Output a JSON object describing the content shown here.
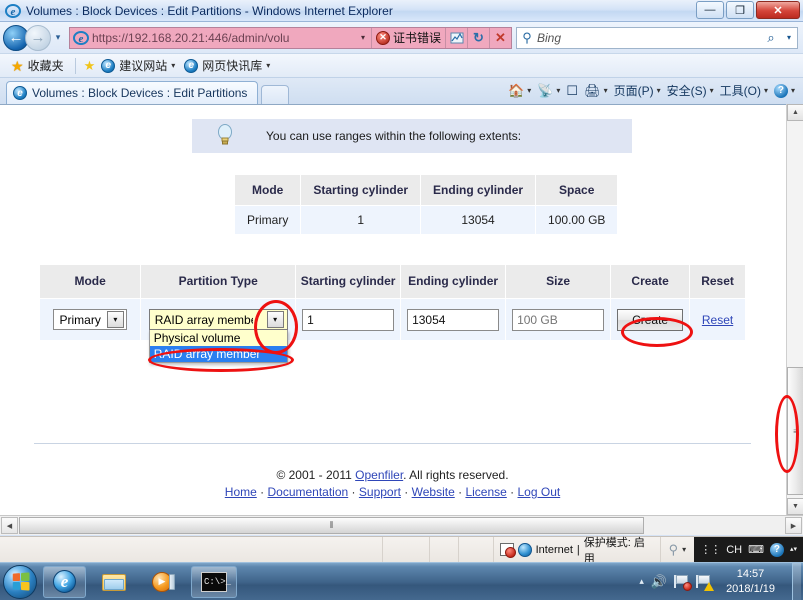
{
  "window": {
    "title": "Volumes : Block Devices : Edit Partitions - Windows Internet Explorer",
    "minimize_label": "—",
    "restore_label": "❐",
    "close_label": "✕"
  },
  "nav": {
    "back_label": "←",
    "forward_label": "→",
    "history_label": "▾",
    "url": "https://192.168.20.21:446/admin/volu",
    "url_dropdown_label": "▾",
    "cert_error_label": "证书错误",
    "cert_shield_label": "✕",
    "compat_view_label": "⛶",
    "refresh_label": "↻",
    "stop_label": "✕"
  },
  "search": {
    "placeholder": "Bing",
    "go_label": "⌕",
    "dropdown_label": "▾"
  },
  "favorites": {
    "favorites_label": "收藏夹",
    "items": [
      {
        "label": "建议网站",
        "caret": "▾"
      },
      {
        "label": "网页快讯库",
        "caret": "▾"
      }
    ]
  },
  "tabs": {
    "active_tab_label": "Volumes : Block Devices : Edit Partitions",
    "new_tab_label": ""
  },
  "commandbar": {
    "home_label": "",
    "feeds_label": "",
    "mail_label": "",
    "print_label": "",
    "page_label": "页面(P)",
    "safety_label": "安全(S)",
    "tools_label": "工具(O)",
    "help_label": "?",
    "caret": "▾"
  },
  "page": {
    "tip": {
      "icon": "lightbulb-icon",
      "text": "You can use ranges within the following extents:"
    },
    "extents_table": {
      "headers": [
        "Mode",
        "Starting cylinder",
        "Ending cylinder",
        "Space"
      ],
      "rows": [
        [
          "Primary",
          "1",
          "13054",
          "100.00 GB"
        ]
      ]
    },
    "create_table": {
      "headers": [
        "Mode",
        "Partition Type",
        "Starting cylinder",
        "Ending cylinder",
        "Size",
        "Create",
        "Reset"
      ],
      "row": {
        "mode_value": "Primary",
        "mode_arrow": "▾",
        "partition_type_value": "RAID array member",
        "partition_type_arrow": "▾",
        "partition_type_options": [
          "Physical volume",
          "RAID array member"
        ],
        "partition_type_selected_index": 1,
        "starting_cylinder_value": "1",
        "ending_cylinder_value": "13054",
        "size_placeholder": "100 GB",
        "create_label": "Create",
        "reset_label": "Reset"
      }
    },
    "footer": {
      "copyright_prefix": "© 2001 - 2011 ",
      "copyright_link": "Openfiler",
      "copyright_suffix": ". All rights reserved.",
      "links": [
        "Home",
        "Documentation",
        "Support",
        "Website",
        "License",
        "Log Out"
      ],
      "separator": "·"
    }
  },
  "scrollbars": {
    "v_up_label": "▲",
    "v_down_label": "▼",
    "v_thumb_grip": "≡",
    "h_left_label": "◀",
    "h_right_label": "▶",
    "h_thumb_grip": "⫴"
  },
  "statusbar": {
    "zone_label": "Internet",
    "separator": "|",
    "protected_mode_label": "保护模式: 启用",
    "zoom_caret": "▾",
    "ime_language": "CH",
    "ime_help": "?",
    "ime_caret": "▴▾"
  },
  "taskbar": {
    "start_label": "",
    "buttons": [
      {
        "name": "internet-explorer",
        "label": ""
      },
      {
        "name": "windows-explorer",
        "label": ""
      },
      {
        "name": "windows-media-player",
        "label": ""
      },
      {
        "name": "command-prompt",
        "label": "C:\\>_"
      }
    ],
    "tray": {
      "show_hidden_label": "▴",
      "volume_label": "🔊",
      "network_label": "",
      "action_center_label": ""
    },
    "clock": {
      "time": "14:57",
      "date": "2018/1/19"
    }
  },
  "colors": {
    "annotation_red": "#ee1111",
    "table_header_bg": "#ebebeb",
    "table_row_bg": "#eef4fd",
    "tip_bg": "#dfe5f3",
    "address_bar_error_bg": "#f0a8be",
    "link_blue": "#2f46b8",
    "dropdown_bg": "#ffffcc",
    "dropdown_highlight": "#2a7ff0"
  }
}
